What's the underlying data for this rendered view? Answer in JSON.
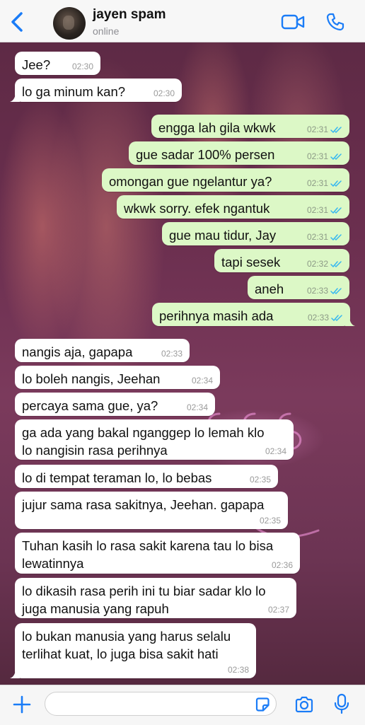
{
  "header": {
    "contact_name": "jayen spam",
    "status": "online",
    "icons": [
      "back-chevron-icon",
      "video-call-icon",
      "phone-call-icon"
    ]
  },
  "colors": {
    "accent": "#1a7cf7",
    "outgoing_bubble": "#dcf8c6",
    "incoming_bubble": "#ffffff",
    "read_ticks": "#34b7f1"
  },
  "messages": [
    {
      "dir": "in",
      "text": "Jee?",
      "time": "02:30"
    },
    {
      "dir": "in",
      "text": "lo ga minum kan?",
      "time": "02:30"
    },
    {
      "dir": "out",
      "text": "engga lah gila wkwk",
      "time": "02:31"
    },
    {
      "dir": "out",
      "text": "gue sadar 100% persen",
      "time": "02:31"
    },
    {
      "dir": "out",
      "text": "omongan gue ngelantur ya?",
      "time": "02:31"
    },
    {
      "dir": "out",
      "text": "wkwk sorry. efek ngantuk",
      "time": "02:31"
    },
    {
      "dir": "out",
      "text": "gue mau tidur, Jay",
      "time": "02:31"
    },
    {
      "dir": "out",
      "text": "tapi sesek",
      "time": "02:32"
    },
    {
      "dir": "out",
      "text": "aneh",
      "time": "02:33"
    },
    {
      "dir": "out",
      "text": "perihnya masih ada",
      "time": "02:33"
    },
    {
      "dir": "in",
      "text": "nangis aja, gapapa",
      "time": "02:33"
    },
    {
      "dir": "in",
      "text": "lo boleh nangis, Jeehan",
      "time": "02:34"
    },
    {
      "dir": "in",
      "text": "percaya sama gue, ya?",
      "time": "02:34"
    },
    {
      "dir": "in",
      "text": "ga ada yang bakal nganggep lo lemah klo\nlo nangisin rasa perihnya",
      "time": "02:34"
    },
    {
      "dir": "in",
      "text": "lo di tempat teraman lo, lo bebas",
      "time": "02:35"
    },
    {
      "dir": "in",
      "text": "jujur sama rasa sakitnya, Jeehan. gapapa",
      "time": "02:35"
    },
    {
      "dir": "in",
      "text": "Tuhan kasih lo rasa sakit karena tau lo bisa\nlewatinnya",
      "time": "02:36"
    },
    {
      "dir": "in",
      "text": "lo dikasih rasa perih ini tu biar sadar klo lo\njuga manusia yang rapuh",
      "time": "02:37"
    },
    {
      "dir": "in",
      "text": "lo bukan manusia yang harus selalu\nterlihat kuat, lo juga bisa sakit hati",
      "time": "02:38"
    }
  ],
  "composer": {
    "value": "",
    "icons": [
      "plus-icon",
      "sticker-icon",
      "camera-icon",
      "microphone-icon"
    ]
  }
}
